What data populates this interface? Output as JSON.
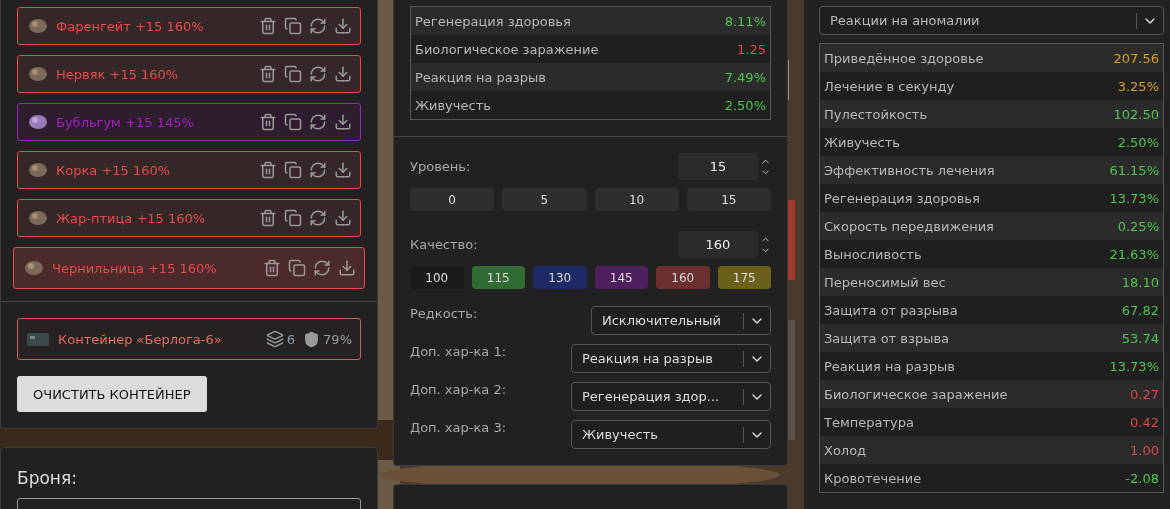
{
  "artifacts": [
    {
      "name": "Фаренгейт +15 160%",
      "color": "#e84a4a",
      "selected": false
    },
    {
      "name": "Нервяк +15 160%",
      "color": "#e84a4a",
      "selected": false
    },
    {
      "name": "Бубльгум +15 145%",
      "color": "#a020c0",
      "selected": false
    },
    {
      "name": "Корка +15 160%",
      "color": "#e84a4a",
      "selected": false
    },
    {
      "name": "Жар-птица +15 160%",
      "color": "#e84a4a",
      "selected": false
    },
    {
      "name": "Чернильница +15 160%",
      "color": "#e84a4a",
      "selected": true
    }
  ],
  "container": {
    "name": "Контейнер «Берлога-6»",
    "slots": "6",
    "protection": "79%"
  },
  "clear_button": "ОЧИСТИТЬ КОНТЕЙНЕР",
  "armor": {
    "title": "Броня:"
  },
  "artifact_stats": [
    {
      "name": "Регенерация здоровья",
      "value": "8.11%",
      "color": "#4cc74c"
    },
    {
      "name": "Биологическое заражение",
      "value": "1.25",
      "color": "#d84a4a"
    },
    {
      "name": "Реакция на разрыв",
      "value": "7.49%",
      "color": "#4cc74c"
    },
    {
      "name": "Живучесть",
      "value": "2.50%",
      "color": "#4cc74c"
    }
  ],
  "level": {
    "label": "Уровень:",
    "value": "15",
    "presets": [
      "0",
      "5",
      "10",
      "15"
    ]
  },
  "quality": {
    "label": "Качество:",
    "value": "160",
    "presets": [
      {
        "label": "100",
        "color": "#1a1a1a"
      },
      {
        "label": "115",
        "color": "#2f6b32"
      },
      {
        "label": "130",
        "color": "#1e2a66"
      },
      {
        "label": "145",
        "color": "#4e1f5c"
      },
      {
        "label": "160",
        "color": "#6b2f2f"
      },
      {
        "label": "175",
        "color": "#6b5f1a"
      }
    ]
  },
  "selects": [
    {
      "label": "Редкость:",
      "value": "Исключительный"
    },
    {
      "label": "Доп. хар-ка 1:",
      "value": "Реакция на разрыв"
    },
    {
      "label": "Доп. хар-ка 2:",
      "value": "Регенерация здор..."
    },
    {
      "label": "Доп. хар-ка 3:",
      "value": "Живучесть"
    }
  ],
  "summary_select": "Реакции на аномалии",
  "summary_stats": [
    {
      "name": "Приведённое здоровье",
      "value": "207.56",
      "color": "#d9a020"
    },
    {
      "name": "Лечение в секунду",
      "value": "3.25%",
      "color": "#d9a020"
    },
    {
      "name": "Пулестойкость",
      "value": "102.50",
      "color": "#4cc74c"
    },
    {
      "name": "Живучесть",
      "value": "2.50%",
      "color": "#4cc74c"
    },
    {
      "name": "Эффективность лечения",
      "value": "61.15%",
      "color": "#4cc74c"
    },
    {
      "name": "Регенерация здоровья",
      "value": "13.73%",
      "color": "#4cc74c"
    },
    {
      "name": "Скорость передвижения",
      "value": "0.25%",
      "color": "#4cc74c"
    },
    {
      "name": "Выносливость",
      "value": "21.63%",
      "color": "#4cc74c"
    },
    {
      "name": "Переносимый вес",
      "value": "18.10",
      "color": "#4cc74c"
    },
    {
      "name": "Защита от разрыва",
      "value": "67.82",
      "color": "#4cc74c"
    },
    {
      "name": "Защита от взрыва",
      "value": "53.74",
      "color": "#4cc74c"
    },
    {
      "name": "Реакция на разрыв",
      "value": "13.73%",
      "color": "#4cc74c"
    },
    {
      "name": "Биологическое заражение",
      "value": "0.27",
      "color": "#d84a4a"
    },
    {
      "name": "Температура",
      "value": "0.42",
      "color": "#d84a4a"
    },
    {
      "name": "Холод",
      "value": "1.00",
      "color": "#d84a4a"
    },
    {
      "name": "Кровотечение",
      "value": "-2.08",
      "color": "#4cc74c"
    }
  ]
}
